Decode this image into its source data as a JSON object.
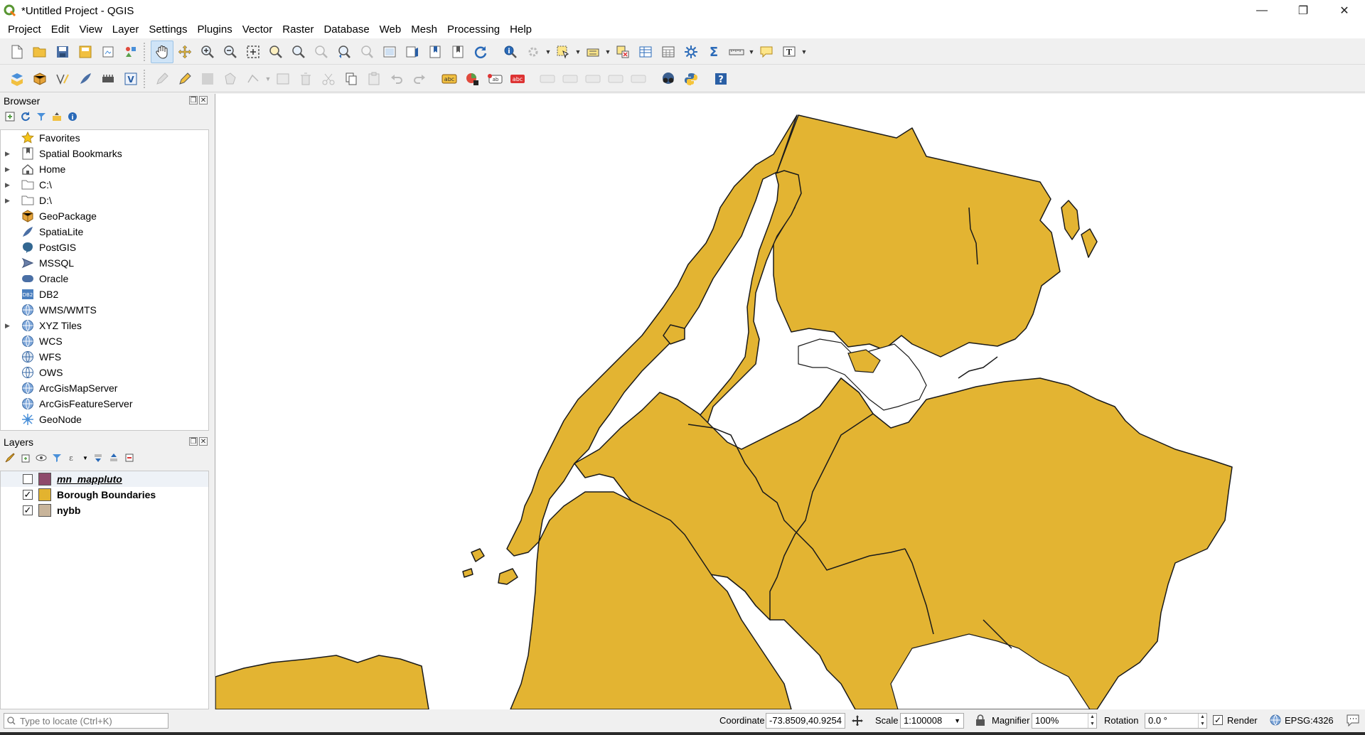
{
  "window": {
    "title": "*Untitled Project - QGIS",
    "controls": [
      "—",
      "❐",
      "✕"
    ]
  },
  "menubar": {
    "items": [
      "Project",
      "Edit",
      "View",
      "Layer",
      "Settings",
      "Plugins",
      "Vector",
      "Raster",
      "Database",
      "Web",
      "Mesh",
      "Processing",
      "Help"
    ]
  },
  "toolbar1": {
    "buttons": [
      "new-project",
      "open-project",
      "save-project",
      "save-as",
      "print-layout",
      "style-manager",
      "pan",
      "pan-to-selection",
      "zoom-in",
      "zoom-out",
      "zoom-full",
      "zoom-to-selection",
      "zoom-to-layer",
      "zoom-native",
      "zoom-last",
      "zoom-next",
      "new-map-view",
      "new-3d-view",
      "new-bookmark",
      "show-bookmarks",
      "refresh",
      "identify",
      "run-action",
      "select-features",
      "deselect",
      "open-attribute-table",
      "field-calculator",
      "statistical-summary",
      "measure",
      "map-tips",
      "text-annotation"
    ]
  },
  "toolbar2": {
    "buttons": [
      "data-source-manager",
      "new-geopackage-layer",
      "new-shapefile-layer",
      "new-spatialite-layer",
      "new-virtual-layer",
      "current-edits",
      "toggle-editing",
      "save-edits",
      "add-polygon",
      "vertex-tool",
      "delete-selected",
      "cut",
      "copy",
      "paste",
      "undo",
      "redo",
      "label-tool",
      "diagram",
      "pin-labels",
      "show-hide-labels",
      "move-label",
      "rotate-label",
      "change-label",
      "plugin-a",
      "plugin-b",
      "python-console",
      "help"
    ]
  },
  "browser": {
    "title": "Browser",
    "items": [
      {
        "label": "Favorites",
        "expandable": false,
        "icon": "star-icon"
      },
      {
        "label": "Spatial Bookmarks",
        "expandable": true,
        "icon": "bookmark-icon"
      },
      {
        "label": "Home",
        "expandable": true,
        "icon": "home-icon"
      },
      {
        "label": "C:\\",
        "expandable": true,
        "icon": "folder-icon"
      },
      {
        "label": "D:\\",
        "expandable": true,
        "icon": "folder-icon"
      },
      {
        "label": "GeoPackage",
        "expandable": false,
        "icon": "geopackage-icon"
      },
      {
        "label": "SpatiaLite",
        "expandable": false,
        "icon": "spatialite-icon"
      },
      {
        "label": "PostGIS",
        "expandable": false,
        "icon": "postgis-icon"
      },
      {
        "label": "MSSQL",
        "expandable": false,
        "icon": "mssql-icon"
      },
      {
        "label": "Oracle",
        "expandable": false,
        "icon": "oracle-icon"
      },
      {
        "label": "DB2",
        "expandable": false,
        "icon": "db2-icon"
      },
      {
        "label": "WMS/WMTS",
        "expandable": false,
        "icon": "globe-icon"
      },
      {
        "label": "XYZ Tiles",
        "expandable": true,
        "icon": "globe-icon"
      },
      {
        "label": "WCS",
        "expandable": false,
        "icon": "globe-icon"
      },
      {
        "label": "WFS",
        "expandable": false,
        "icon": "globe-icon"
      },
      {
        "label": "OWS",
        "expandable": false,
        "icon": "globe-icon"
      },
      {
        "label": "ArcGisMapServer",
        "expandable": false,
        "icon": "globe-icon"
      },
      {
        "label": "ArcGisFeatureServer",
        "expandable": false,
        "icon": "globe-icon"
      },
      {
        "label": "GeoNode",
        "expandable": false,
        "icon": "geonode-icon"
      }
    ]
  },
  "layers": {
    "title": "Layers",
    "items": [
      {
        "label": "mn_mappluto",
        "checked": false,
        "color": "#8e4a6b",
        "italic": true
      },
      {
        "label": "Borough Boundaries",
        "checked": true,
        "color": "#e3b32f",
        "italic": false
      },
      {
        "label": "nybb",
        "checked": true,
        "color": "#c8b49a",
        "italic": false
      }
    ]
  },
  "map": {
    "fill_color": "#e3b432",
    "stroke_color": "#1a1a1a"
  },
  "statusbar": {
    "locator_placeholder": "Type to locate (Ctrl+K)",
    "coordinate_label": "Coordinate",
    "coordinate_value": "-73.8509,40.9254",
    "scale_label": "Scale",
    "scale_value": "1:100008",
    "magnifier_label": "Magnifier",
    "magnifier_value": "100%",
    "rotation_label": "Rotation",
    "rotation_value": "0.0 °",
    "render_label": "Render",
    "render_checked": true,
    "crs": "EPSG:4326"
  }
}
